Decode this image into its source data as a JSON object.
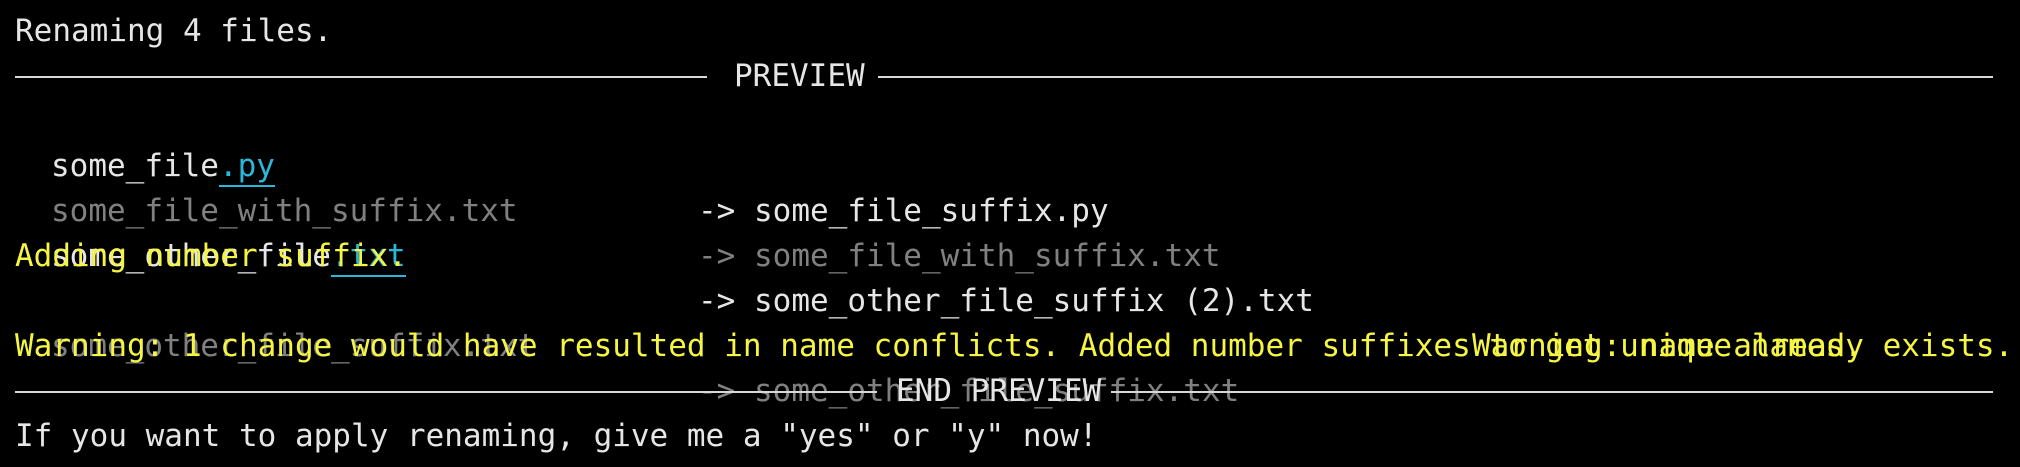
{
  "terminal": {
    "header": "Renaming 4 files.",
    "preview_label": "PREVIEW",
    "end_preview_label": "END PREVIEW",
    "rows": [
      {
        "src_base": "some_file",
        "src_ext": ".py",
        "arrow": "->",
        "dst": "some_file_suffix.py",
        "unchanged": false
      },
      {
        "src_full": "some_file_with_suffix.txt",
        "arrow": "->",
        "dst": "some_file_with_suffix.txt",
        "unchanged": true
      },
      {
        "src_base": "some_other_file",
        "src_ext": ".txt",
        "arrow": "->",
        "dst": "some_other_file_suffix (2).txt",
        "unchanged": false,
        "warning": "Warning: name already exists."
      },
      {
        "src_full": "some_other_file_suffix.txt",
        "arrow": "->",
        "dst": "some_other_file_suffix.txt",
        "unchanged": true
      }
    ],
    "wrapped_warning": "Adding number suffix.",
    "conflict_warning": "Warning: 1 change would have resulted in name conflicts. Added number suffixes to get unique names.",
    "prompt": "If you want to apply renaming, give me a \"yes\" or \"y\" now!"
  },
  "colors": {
    "background": "#000000",
    "text": "#e6e6e6",
    "dim": "#808080",
    "extension": "#29b8db",
    "warning": "#f5f543",
    "rule": "#d8d8d8"
  }
}
